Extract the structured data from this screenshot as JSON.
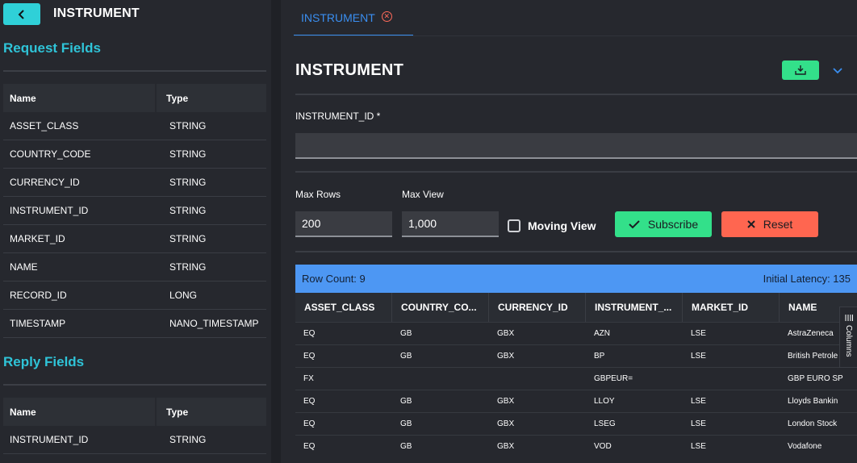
{
  "left": {
    "title": "INSTRUMENT",
    "request_section_title": "Request Fields",
    "reply_section_title": "Reply Fields",
    "columns": {
      "name": "Name",
      "type": "Type"
    },
    "request_fields": [
      {
        "name": "ASSET_CLASS",
        "type": "STRING"
      },
      {
        "name": "COUNTRY_CODE",
        "type": "STRING"
      },
      {
        "name": "CURRENCY_ID",
        "type": "STRING"
      },
      {
        "name": "INSTRUMENT_ID",
        "type": "STRING"
      },
      {
        "name": "MARKET_ID",
        "type": "STRING"
      },
      {
        "name": "NAME",
        "type": "STRING"
      },
      {
        "name": "RECORD_ID",
        "type": "LONG"
      },
      {
        "name": "TIMESTAMP",
        "type": "NANO_TIMESTAMP"
      }
    ],
    "reply_fields": [
      {
        "name": "INSTRUMENT_ID",
        "type": "STRING"
      }
    ]
  },
  "tab": {
    "label": "INSTRUMENT"
  },
  "form": {
    "title": "INSTRUMENT",
    "instrument_id_label": "INSTRUMENT_ID *",
    "instrument_id_value": "",
    "max_rows_label": "Max Rows",
    "max_rows_value": "200",
    "max_view_label": "Max View",
    "max_view_value": "1,000",
    "moving_view_label": "Moving View",
    "subscribe_label": "Subscribe",
    "reset_label": "Reset"
  },
  "grid": {
    "row_count": "Row Count: 9",
    "latency": "Initial Latency: 135",
    "columns_tab": "Columns",
    "headers": [
      "ASSET_CLASS",
      "COUNTRY_CO...",
      "CURRENCY_ID",
      "INSTRUMENT_...",
      "MARKET_ID",
      "NAME"
    ],
    "rows": [
      [
        "EQ",
        "GB",
        "GBX",
        "AZN",
        "LSE",
        "AstraZeneca"
      ],
      [
        "EQ",
        "GB",
        "GBX",
        "BP",
        "LSE",
        "British Petrole"
      ],
      [
        "FX",
        "",
        "",
        "GBPEUR=",
        "",
        "GBP EURO SP"
      ],
      [
        "EQ",
        "GB",
        "GBX",
        "LLOY",
        "LSE",
        "Lloyds Bankin"
      ],
      [
        "EQ",
        "GB",
        "GBX",
        "LSEG",
        "LSE",
        "London Stock"
      ],
      [
        "EQ",
        "GB",
        "GBX",
        "VOD",
        "LSE",
        "Vodafone"
      ]
    ]
  },
  "colors": {
    "accent_cyan": "#2fc4d8",
    "accent_blue": "#3a8ef0",
    "status_bar": "#4d97f3",
    "subscribe_green": "#33e08a",
    "reset_red": "#ff6650"
  },
  "icons": {
    "back": "chevron-left-icon",
    "tab_close": "close-circle-icon",
    "download": "download-icon",
    "collapse": "chevron-down-icon",
    "subscribe": "check-icon",
    "reset": "x-icon",
    "columns": "columns-icon"
  }
}
